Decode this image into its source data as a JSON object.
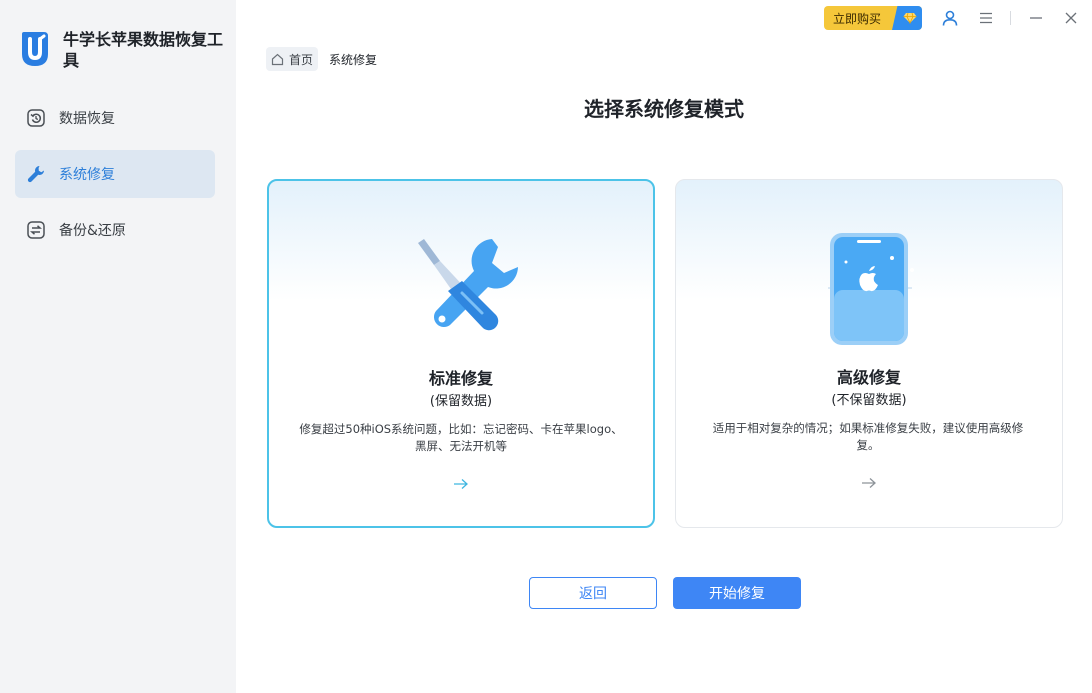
{
  "app": {
    "title": "牛学长苹果数据恢复工具"
  },
  "sidebar": {
    "items": [
      {
        "label": "数据恢复",
        "icon": "restore-icon",
        "active": false
      },
      {
        "label": "系统修复",
        "icon": "wrench-icon",
        "active": true
      },
      {
        "label": "备份&还原",
        "icon": "backup-icon",
        "active": false
      }
    ]
  },
  "titlebar": {
    "buy_label": "立即购买",
    "icons": [
      "diamond-icon",
      "user-icon",
      "menu-icon",
      "minimize-icon",
      "close-icon"
    ]
  },
  "breadcrumb": {
    "home": "首页",
    "current": "系统修复"
  },
  "main": {
    "title": "选择系统修复模式",
    "cards": [
      {
        "title": "标准修复",
        "subtitle": "(保留数据)",
        "desc_line1": "修复超过50种iOS系统问题，比如：忘记密码、卡在苹果logo、",
        "desc_line2": "黑屏、无法开机等",
        "selected": true
      },
      {
        "title": "高级修复",
        "subtitle": "(不保留数据)",
        "desc_line1": "适用于相对复杂的情况；如果标准修复失败，建议使用高级修",
        "desc_line2": "复。",
        "selected": false
      }
    ]
  },
  "buttons": {
    "back": "返回",
    "start": "开始修复"
  },
  "colors": {
    "accent": "#3e86f5",
    "selected_border": "#4cc3e8",
    "sidebar_bg": "#f3f4f6",
    "buy_bg": "#f5c73a"
  }
}
